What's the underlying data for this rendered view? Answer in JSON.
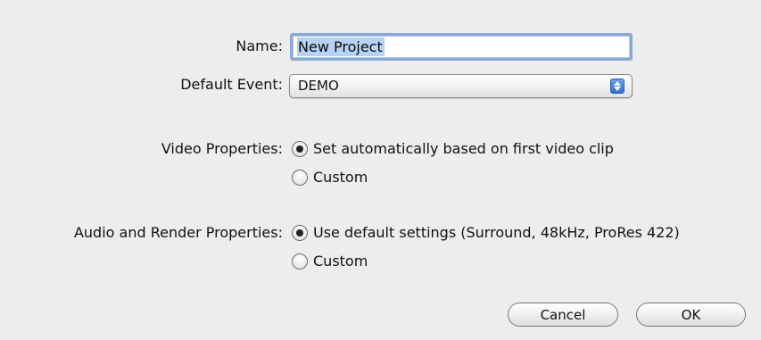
{
  "form": {
    "name_label": "Name:",
    "name_value": "New Project",
    "event_label": "Default Event:",
    "event_value": "DEMO",
    "video_label": "Video Properties:",
    "video_option_auto": "Set automatically based on first video clip",
    "video_option_custom": "Custom",
    "audio_label": "Audio and Render Properties:",
    "audio_option_default": "Use default settings (Surround, 48kHz, ProRes 422)",
    "audio_option_custom": "Custom"
  },
  "buttons": {
    "cancel": "Cancel",
    "ok": "OK"
  },
  "icons": {
    "select_stepper": "up-down-arrows-icon",
    "radio": "radio-button-icon"
  },
  "colors": {
    "focus_ring": "#87a9d8",
    "selection": "#b7d2f3",
    "stepper_blue": "#2f6fd4",
    "background": "#ededed"
  }
}
